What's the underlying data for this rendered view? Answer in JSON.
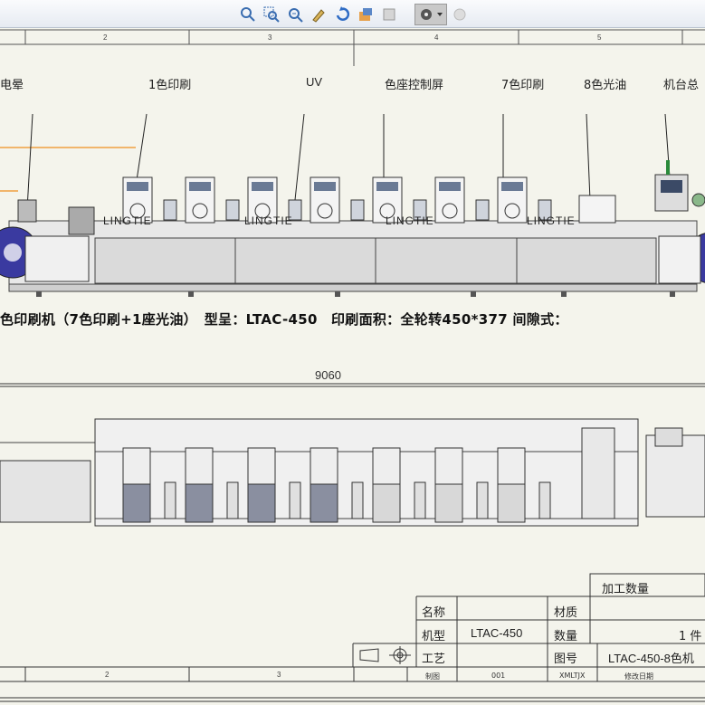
{
  "toolbar": {
    "icons": [
      "zoom-to-fit-icon",
      "zoom-area-icon",
      "zoom-in-out-icon",
      "select-icon",
      "rotate-icon",
      "pan-icon",
      "view-orientation-icon",
      "display-style-icon",
      "appearance-icon"
    ]
  },
  "ruler": {
    "top_zones": [
      "2",
      "3",
      "4",
      "5"
    ],
    "bottom_zones": [
      "2",
      "3"
    ]
  },
  "callouts": {
    "dryer": "电晕",
    "print1": "1色印刷",
    "uv": "UV",
    "screen": "色座控制屏",
    "print7": "7色印刷",
    "varnish": "8色光油",
    "machine": "机台总"
  },
  "unit_label": "LINGTIE",
  "spec_line": "色印刷机（7色印刷+1座光油）　型呈：LTAC-450　印刷面积：全轮转450*377 间隙式：",
  "dimension": "9060",
  "title_block": {
    "qty_header": "加工数量",
    "name_label": "名称",
    "material_label": "材质",
    "model_label": "机型",
    "model_value": "LTAC-450",
    "count_label": "数量",
    "count_value": "1 件",
    "process_label": "工艺",
    "drawing_no_label": "图号",
    "drawing_no_value": "LTAC-450-8色机",
    "drawn_label": "制图",
    "drawn_value": "001",
    "checked_value": "XMLTJX",
    "revision_label": "修改日期"
  },
  "colors": {
    "accent_orange": "#f0a040",
    "frame_blue": "#1e3a8a",
    "panel_gray": "#d8d8d8"
  }
}
